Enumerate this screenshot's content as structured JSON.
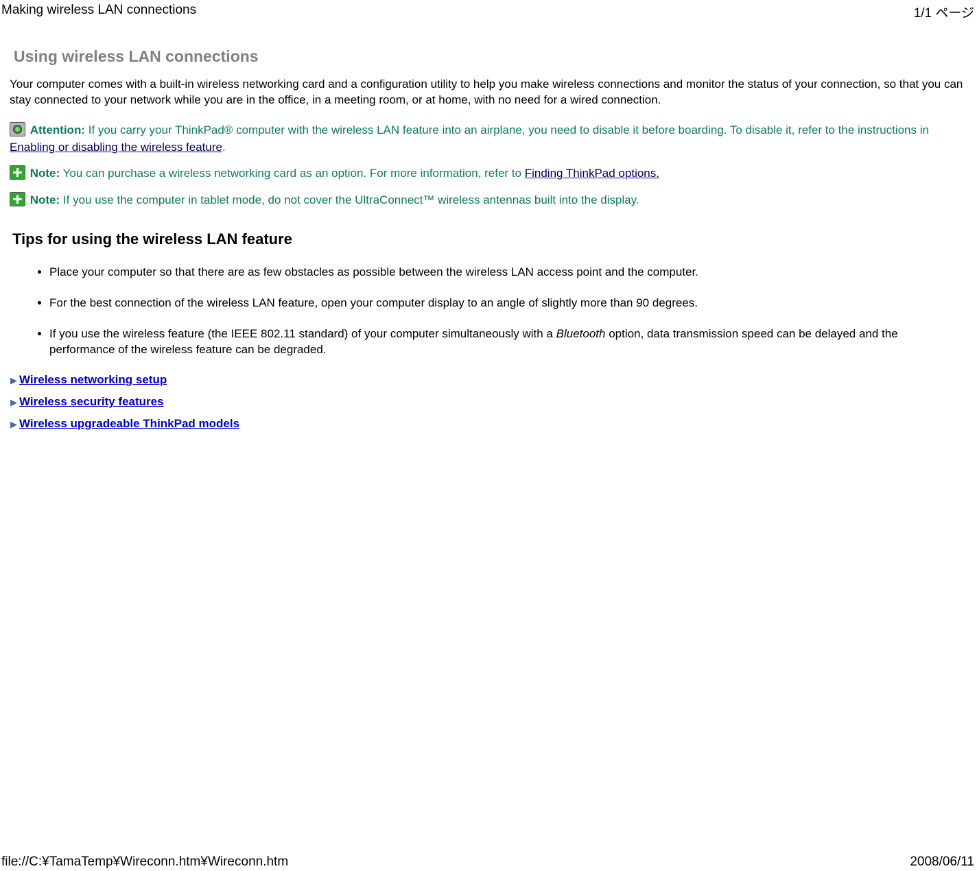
{
  "header": {
    "title": "Making wireless LAN connections",
    "page_counter": "1/1 ページ"
  },
  "footer": {
    "path": "file://C:¥TamaTemp¥Wireconn.htm¥Wireconn.htm",
    "date": "2008/06/11"
  },
  "page_title": "Using wireless LAN connections",
  "intro": "Your computer comes with a built-in wireless networking card and a configuration utility to help you make wireless connections and monitor the status of your connection, so that you can stay connected to your network while you are in the office, in a meeting room, or at home, with no need for a wired connection.",
  "attention": {
    "label": "Attention:",
    "text_before_link": " If you carry your ThinkPad® computer with the wireless LAN feature into an airplane, you need to disable it before boarding. To disable it, refer to the instructions in ",
    "link_text": "Enabling or disabling the wireless feature",
    "text_after_link": "."
  },
  "note1": {
    "label": "Note:",
    "text_before_link": " You can purchase a wireless networking card as an option. For more information, refer to ",
    "link_text": "Finding ThinkPad options."
  },
  "note2": {
    "label": "Note:",
    "text": " If you use the computer in tablet mode, do not cover the UltraConnect™ wireless antennas built into the display."
  },
  "tips_heading": "Tips for using the wireless LAN feature",
  "tips": [
    {
      "text": "Place your computer so that there are as few obstacles as possible between the wireless LAN access point and the computer."
    },
    {
      "text": "For the best connection of the wireless LAN feature, open your computer display to an angle of slightly more than 90 degrees."
    },
    {
      "pre": "If you use the wireless feature (the IEEE 802.11 standard) of your computer simultaneously with a ",
      "italic": "Bluetooth",
      "post": " option, data transmission speed can be delayed and the performance of the wireless feature can be degraded."
    }
  ],
  "related": [
    {
      "label": "Wireless networking setup"
    },
    {
      "label": "Wireless security features"
    },
    {
      "label": "Wireless upgradeable ThinkPad models"
    }
  ]
}
